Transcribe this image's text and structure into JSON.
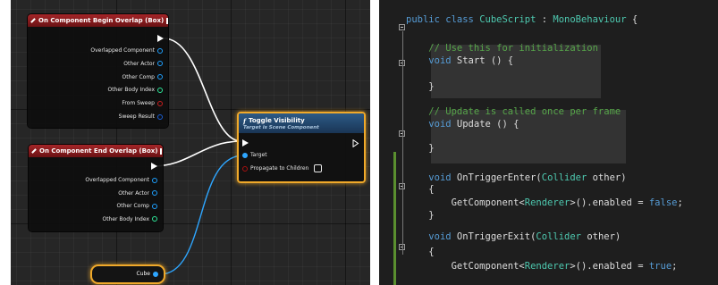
{
  "blueprint": {
    "begin_overlap": {
      "title": "On Component Begin Overlap (Box)",
      "pins": [
        {
          "label": "Overlapped Component",
          "color": "#1ea0ff"
        },
        {
          "label": "Other Actor",
          "color": "#1ea0ff"
        },
        {
          "label": "Other Comp",
          "color": "#1ea0ff"
        },
        {
          "label": "Other Body Index",
          "color": "#2ee89a"
        },
        {
          "label": "From Sweep",
          "color": "#c81e1e"
        },
        {
          "label": "Sweep Result",
          "color": "#1a5fd6"
        }
      ]
    },
    "end_overlap": {
      "title": "On Component End Overlap (Box)",
      "pins": [
        {
          "label": "Overlapped Component",
          "color": "#1ea0ff"
        },
        {
          "label": "Other Actor",
          "color": "#1ea0ff"
        },
        {
          "label": "Other Comp",
          "color": "#1ea0ff"
        },
        {
          "label": "Other Body Index",
          "color": "#2ee89a"
        }
      ]
    },
    "toggle_visibility": {
      "icon": "f",
      "title": "Toggle Visibility",
      "subtitle": "Target is Scene Component",
      "target_label": "Target",
      "propagate_label": "Propagate to Children",
      "propagate_checked": false
    },
    "cube_var": {
      "label": "Cube"
    }
  },
  "editor": {
    "lines": [
      [
        {
          "t": "public class ",
          "c": "kw"
        },
        {
          "t": "CubeScript",
          "c": "cls"
        },
        {
          "t": " : ",
          "c": ""
        },
        {
          "t": "MonoBehaviour",
          "c": "cls"
        },
        {
          "t": " {",
          "c": ""
        }
      ],
      [],
      [
        {
          "t": "    // Use this for initialization",
          "c": "cmt"
        }
      ],
      [
        {
          "t": "    ",
          "c": ""
        },
        {
          "t": "void",
          "c": "kw"
        },
        {
          "t": " Start () {",
          "c": ""
        }
      ],
      [],
      [
        {
          "t": "    }",
          "c": ""
        }
      ],
      [],
      [
        {
          "t": "    // Update is called once per frame",
          "c": "cmt"
        }
      ],
      [
        {
          "t": "    ",
          "c": ""
        },
        {
          "t": "void",
          "c": "kw"
        },
        {
          "t": " Update () {",
          "c": ""
        }
      ],
      [],
      [
        {
          "t": "    }",
          "c": ""
        }
      ],
      [],
      [
        {
          "t": "    ",
          "c": ""
        },
        {
          "t": "void",
          "c": "kw"
        },
        {
          "t": " OnTriggerEnter(",
          "c": ""
        },
        {
          "t": "Collider",
          "c": "cls"
        },
        {
          "t": " other)",
          "c": ""
        }
      ],
      [
        {
          "t": "    {",
          "c": ""
        }
      ],
      [
        {
          "t": "        GetComponent<",
          "c": ""
        },
        {
          "t": "Renderer",
          "c": "cls"
        },
        {
          "t": ">().enabled = ",
          "c": ""
        },
        {
          "t": "false",
          "c": "kw"
        },
        {
          "t": ";",
          "c": ""
        }
      ],
      [
        {
          "t": "    }",
          "c": ""
        }
      ],
      [],
      [
        {
          "t": "    ",
          "c": ""
        },
        {
          "t": "void",
          "c": "kw"
        },
        {
          "t": " OnTriggerExit(",
          "c": ""
        },
        {
          "t": "Collider",
          "c": "cls"
        },
        {
          "t": " other)",
          "c": ""
        }
      ],
      [
        {
          "t": "    {",
          "c": ""
        }
      ],
      [
        {
          "t": "        GetComponent<",
          "c": ""
        },
        {
          "t": "Renderer",
          "c": "cls"
        },
        {
          "t": ">().enabled = ",
          "c": ""
        },
        {
          "t": "true",
          "c": "kw"
        },
        {
          "t": ";",
          "c": ""
        }
      ]
    ]
  }
}
